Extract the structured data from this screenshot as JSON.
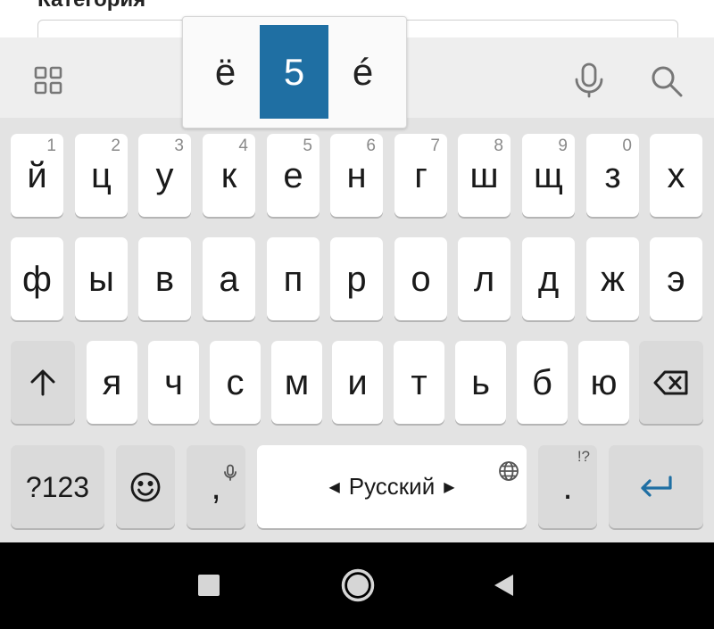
{
  "form": {
    "label": "Категория"
  },
  "popup": {
    "options": [
      "ё",
      "5",
      "é"
    ],
    "selected_index": 1
  },
  "keyboard": {
    "row1": [
      {
        "label": "й",
        "hint": "1"
      },
      {
        "label": "ц",
        "hint": "2"
      },
      {
        "label": "у",
        "hint": "3"
      },
      {
        "label": "к",
        "hint": "4"
      },
      {
        "label": "е",
        "hint": "5"
      },
      {
        "label": "н",
        "hint": "6"
      },
      {
        "label": "г",
        "hint": "7"
      },
      {
        "label": "ш",
        "hint": "8"
      },
      {
        "label": "щ",
        "hint": "9"
      },
      {
        "label": "з",
        "hint": "0"
      },
      {
        "label": "х",
        "hint": ""
      }
    ],
    "row2": [
      "ф",
      "ы",
      "в",
      "а",
      "п",
      "р",
      "о",
      "л",
      "д",
      "ж",
      "э"
    ],
    "row3": [
      "я",
      "ч",
      "с",
      "м",
      "и",
      "т",
      "ь",
      "б",
      "ю"
    ],
    "bottom": {
      "symbols_label": "?123",
      "comma_label": ",",
      "space_label": "Русский",
      "period_label": ".",
      "period_hint": "!?"
    }
  },
  "icons": {
    "toolbar": [
      "grid-icon",
      "mic-icon",
      "search-icon"
    ],
    "keys": [
      "shift-icon",
      "backspace-icon",
      "emoji-icon",
      "globe-icon",
      "enter-icon"
    ],
    "nav": [
      "recents-icon",
      "home-icon",
      "back-icon"
    ]
  },
  "colors": {
    "accent": "#1f6fa3",
    "key": "#ffffff",
    "func_key": "#dadada",
    "keyboard_bg": "#e3e3e3",
    "navbar": "#000000"
  }
}
